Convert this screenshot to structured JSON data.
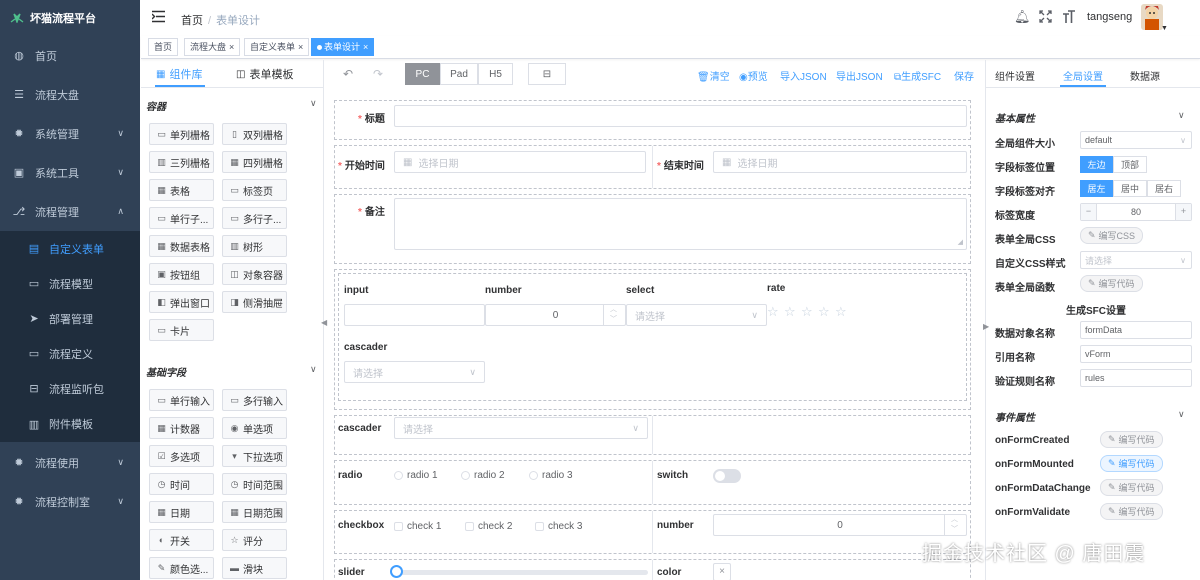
{
  "app": {
    "title": "坏猫流程平台"
  },
  "sidebar": {
    "items": [
      {
        "label": "首页",
        "icon": "dashboard-icon",
        "arrow": ""
      },
      {
        "label": "流程大盘",
        "icon": "list-icon",
        "arrow": ""
      },
      {
        "label": "系统管理",
        "icon": "gear-icon",
        "arrow": "∨"
      },
      {
        "label": "系统工具",
        "icon": "toolbox-icon",
        "arrow": "∨"
      },
      {
        "label": "流程管理",
        "icon": "flow-icon",
        "arrow": "∧"
      }
    ],
    "sub_items": [
      {
        "label": "自定义表单",
        "icon": "form-icon",
        "active": true
      },
      {
        "label": "流程模型",
        "icon": "model-icon"
      },
      {
        "label": "部署管理",
        "icon": "send-icon"
      },
      {
        "label": "流程定义",
        "icon": "define-icon"
      },
      {
        "label": "流程监听包",
        "icon": "listener-icon"
      },
      {
        "label": "附件模板",
        "icon": "attachment-icon"
      }
    ],
    "bottom_items": [
      {
        "label": "流程使用",
        "icon": "gear-icon",
        "arrow": "∨"
      },
      {
        "label": "流程控制室",
        "icon": "gear-icon",
        "arrow": "∨"
      }
    ]
  },
  "header": {
    "breadcrumb": [
      "首页",
      "表单设计"
    ],
    "username": "tangseng"
  },
  "tags": [
    "首页",
    "流程大盘",
    "自定义表单",
    "表单设计"
  ],
  "left_panel": {
    "tabs": [
      "组件库",
      "表单模板"
    ],
    "container_title": "容器",
    "containers": [
      "单列栅格",
      "双列栅格",
      "三列栅格",
      "四列栅格",
      "表格",
      "标签页",
      "单行子...",
      "多行子...",
      "数据表格",
      "树形",
      "按钮组",
      "对象容器",
      "弹出窗口",
      "侧滑抽屉",
      "卡片"
    ],
    "basic_title": "基础字段",
    "basics": [
      "单行输入",
      "多行输入",
      "计数器",
      "单选项",
      "多选项",
      "下拉选项",
      "时间",
      "时间范围",
      "日期",
      "日期范围",
      "开关",
      "评分",
      "颜色选...",
      "滑块"
    ]
  },
  "toolbar": {
    "devices": [
      "PC",
      "Pad",
      "H5"
    ],
    "active_device": "PC",
    "actions": [
      "清空",
      "预览",
      "导入JSON",
      "导出JSON",
      "生成SFC",
      "保存"
    ]
  },
  "form": {
    "title_label": "标题",
    "start_label": "开始时间",
    "start_ph": "选择日期",
    "end_label": "结束时间",
    "end_ph": "选择日期",
    "remark_label": "备注",
    "grid": {
      "input_label": "input",
      "number_label": "number",
      "number_value": "0",
      "select_label": "select",
      "select_ph": "请选择",
      "rate_label": "rate",
      "cascader_label": "cascader",
      "cascader_ph": "请选择"
    },
    "cascader_label": "cascader",
    "cascader_ph": "请选择",
    "radio_label": "radio",
    "radios": [
      "radio 1",
      "radio 2",
      "radio 3"
    ],
    "switch_label": "switch",
    "checkbox_label": "checkbox",
    "checks": [
      "check 1",
      "check 2",
      "check 3"
    ],
    "number_label": "number",
    "number_value": "0",
    "slider_label": "slider",
    "color_label": "color"
  },
  "right_panel": {
    "tabs": [
      "组件设置",
      "全局设置",
      "数据源"
    ],
    "basic_title": "基本属性",
    "size_label": "全局组件大小",
    "size_value": "default",
    "label_pos_label": "字段标签位置",
    "label_pos": [
      "左边",
      "顶部"
    ],
    "label_align_label": "字段标签对齐",
    "label_align": [
      "居左",
      "居中",
      "居右"
    ],
    "label_width_label": "标签宽度",
    "label_width": "80",
    "css_label": "表单全局CSS",
    "css_btn": "编写CSS",
    "custom_css_label": "自定义CSS样式",
    "custom_css_ph": "请选择",
    "func_label": "表单全局函数",
    "func_btn": "编写代码",
    "sfc_title": "生成SFC设置",
    "data_obj_label": "数据对象名称",
    "data_obj": "formData",
    "ref_label": "引用名称",
    "ref": "vForm",
    "rules_label": "验证规则名称",
    "rules": "rules",
    "event_title": "事件属性",
    "events": [
      {
        "name": "onFormCreated",
        "btn": "编写代码"
      },
      {
        "name": "onFormMounted",
        "btn": "编写代码"
      },
      {
        "name": "onFormDataChange",
        "btn": "编写代码"
      },
      {
        "name": "onFormValidate",
        "btn": "编写代码"
      }
    ]
  },
  "watermark": "掘金技术社区 @ 唐田震",
  "colors": {
    "sidebar": "#304156",
    "accent": "#409eff"
  }
}
